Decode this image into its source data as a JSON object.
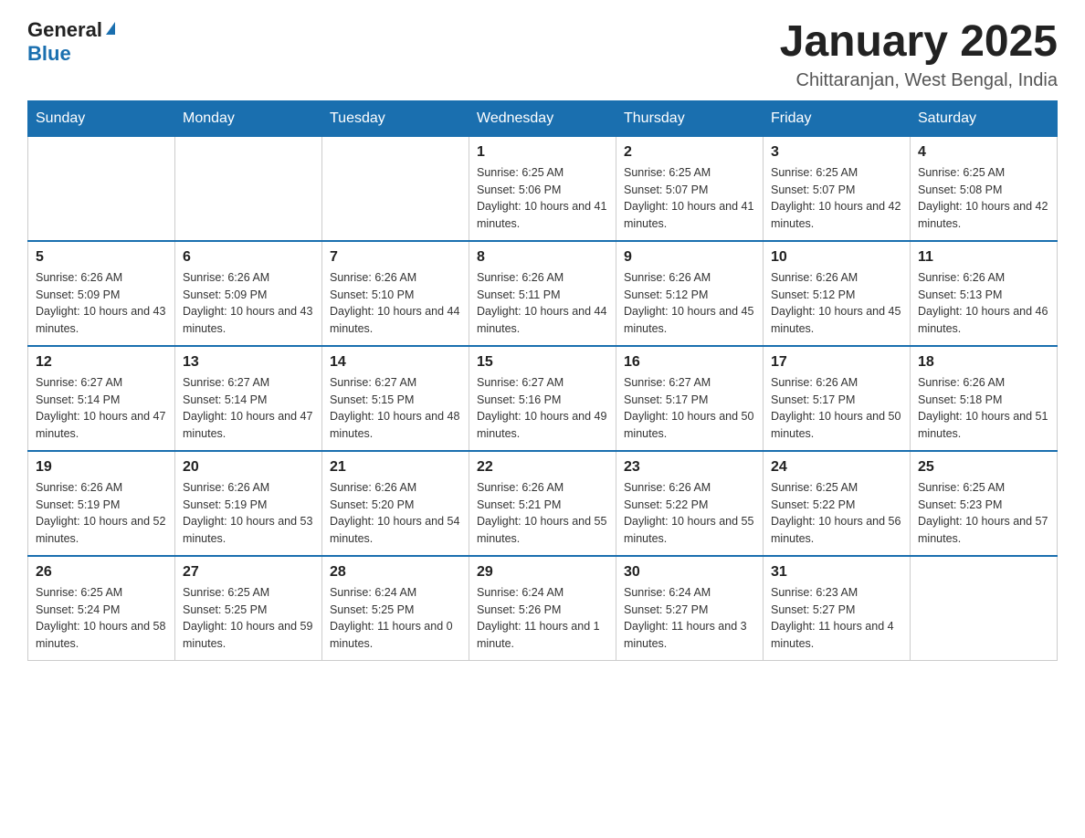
{
  "header": {
    "logo_general": "General",
    "logo_blue": "Blue",
    "title": "January 2025",
    "subtitle": "Chittaranjan, West Bengal, India"
  },
  "days_of_week": [
    "Sunday",
    "Monday",
    "Tuesday",
    "Wednesday",
    "Thursday",
    "Friday",
    "Saturday"
  ],
  "weeks": [
    [
      {
        "day": "",
        "info": ""
      },
      {
        "day": "",
        "info": ""
      },
      {
        "day": "",
        "info": ""
      },
      {
        "day": "1",
        "info": "Sunrise: 6:25 AM\nSunset: 5:06 PM\nDaylight: 10 hours and 41 minutes."
      },
      {
        "day": "2",
        "info": "Sunrise: 6:25 AM\nSunset: 5:07 PM\nDaylight: 10 hours and 41 minutes."
      },
      {
        "day": "3",
        "info": "Sunrise: 6:25 AM\nSunset: 5:07 PM\nDaylight: 10 hours and 42 minutes."
      },
      {
        "day": "4",
        "info": "Sunrise: 6:25 AM\nSunset: 5:08 PM\nDaylight: 10 hours and 42 minutes."
      }
    ],
    [
      {
        "day": "5",
        "info": "Sunrise: 6:26 AM\nSunset: 5:09 PM\nDaylight: 10 hours and 43 minutes."
      },
      {
        "day": "6",
        "info": "Sunrise: 6:26 AM\nSunset: 5:09 PM\nDaylight: 10 hours and 43 minutes."
      },
      {
        "day": "7",
        "info": "Sunrise: 6:26 AM\nSunset: 5:10 PM\nDaylight: 10 hours and 44 minutes."
      },
      {
        "day": "8",
        "info": "Sunrise: 6:26 AM\nSunset: 5:11 PM\nDaylight: 10 hours and 44 minutes."
      },
      {
        "day": "9",
        "info": "Sunrise: 6:26 AM\nSunset: 5:12 PM\nDaylight: 10 hours and 45 minutes."
      },
      {
        "day": "10",
        "info": "Sunrise: 6:26 AM\nSunset: 5:12 PM\nDaylight: 10 hours and 45 minutes."
      },
      {
        "day": "11",
        "info": "Sunrise: 6:26 AM\nSunset: 5:13 PM\nDaylight: 10 hours and 46 minutes."
      }
    ],
    [
      {
        "day": "12",
        "info": "Sunrise: 6:27 AM\nSunset: 5:14 PM\nDaylight: 10 hours and 47 minutes."
      },
      {
        "day": "13",
        "info": "Sunrise: 6:27 AM\nSunset: 5:14 PM\nDaylight: 10 hours and 47 minutes."
      },
      {
        "day": "14",
        "info": "Sunrise: 6:27 AM\nSunset: 5:15 PM\nDaylight: 10 hours and 48 minutes."
      },
      {
        "day": "15",
        "info": "Sunrise: 6:27 AM\nSunset: 5:16 PM\nDaylight: 10 hours and 49 minutes."
      },
      {
        "day": "16",
        "info": "Sunrise: 6:27 AM\nSunset: 5:17 PM\nDaylight: 10 hours and 50 minutes."
      },
      {
        "day": "17",
        "info": "Sunrise: 6:26 AM\nSunset: 5:17 PM\nDaylight: 10 hours and 50 minutes."
      },
      {
        "day": "18",
        "info": "Sunrise: 6:26 AM\nSunset: 5:18 PM\nDaylight: 10 hours and 51 minutes."
      }
    ],
    [
      {
        "day": "19",
        "info": "Sunrise: 6:26 AM\nSunset: 5:19 PM\nDaylight: 10 hours and 52 minutes."
      },
      {
        "day": "20",
        "info": "Sunrise: 6:26 AM\nSunset: 5:19 PM\nDaylight: 10 hours and 53 minutes."
      },
      {
        "day": "21",
        "info": "Sunrise: 6:26 AM\nSunset: 5:20 PM\nDaylight: 10 hours and 54 minutes."
      },
      {
        "day": "22",
        "info": "Sunrise: 6:26 AM\nSunset: 5:21 PM\nDaylight: 10 hours and 55 minutes."
      },
      {
        "day": "23",
        "info": "Sunrise: 6:26 AM\nSunset: 5:22 PM\nDaylight: 10 hours and 55 minutes."
      },
      {
        "day": "24",
        "info": "Sunrise: 6:25 AM\nSunset: 5:22 PM\nDaylight: 10 hours and 56 minutes."
      },
      {
        "day": "25",
        "info": "Sunrise: 6:25 AM\nSunset: 5:23 PM\nDaylight: 10 hours and 57 minutes."
      }
    ],
    [
      {
        "day": "26",
        "info": "Sunrise: 6:25 AM\nSunset: 5:24 PM\nDaylight: 10 hours and 58 minutes."
      },
      {
        "day": "27",
        "info": "Sunrise: 6:25 AM\nSunset: 5:25 PM\nDaylight: 10 hours and 59 minutes."
      },
      {
        "day": "28",
        "info": "Sunrise: 6:24 AM\nSunset: 5:25 PM\nDaylight: 11 hours and 0 minutes."
      },
      {
        "day": "29",
        "info": "Sunrise: 6:24 AM\nSunset: 5:26 PM\nDaylight: 11 hours and 1 minute."
      },
      {
        "day": "30",
        "info": "Sunrise: 6:24 AM\nSunset: 5:27 PM\nDaylight: 11 hours and 3 minutes."
      },
      {
        "day": "31",
        "info": "Sunrise: 6:23 AM\nSunset: 5:27 PM\nDaylight: 11 hours and 4 minutes."
      },
      {
        "day": "",
        "info": ""
      }
    ]
  ]
}
